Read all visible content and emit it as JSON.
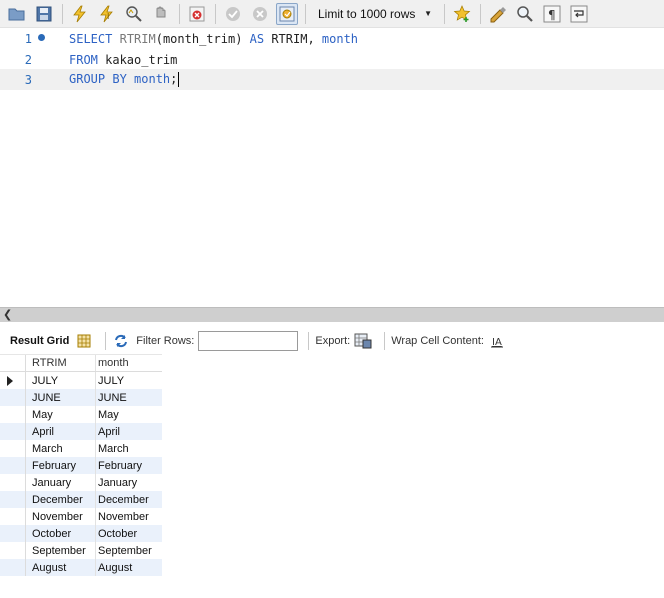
{
  "toolbar": {
    "limit_label": "Limit to 1000 rows",
    "icons": [
      "open-folder-icon",
      "save-icon",
      "execute-icon",
      "execute-current-icon",
      "explain-icon",
      "stop-icon",
      "toggle-error-icon",
      "commit-icon",
      "rollback-icon",
      "autocommit-icon",
      "add-snippet-icon",
      "beautify-icon",
      "find-icon",
      "invisible-chars-icon",
      "wrap-icon"
    ]
  },
  "editor": {
    "lines": [
      {
        "num": "1"
      },
      {
        "num": "2"
      },
      {
        "num": "3"
      }
    ],
    "l1": {
      "kw1": "SELECT",
      "fn": "RTRIM",
      "p1": "(month_trim) ",
      "kw2": "AS",
      "t2": " RTRIM, ",
      "kw3": "month"
    },
    "l2": {
      "kw1": "FROM",
      "t1": " kakao_trim"
    },
    "l3": {
      "kw1": "GROUP BY",
      "t1": " ",
      "kw2": "month",
      "t2": ";"
    }
  },
  "result_toolbar": {
    "result_grid": "Result Grid",
    "filter_rows": "Filter Rows:",
    "export": "Export:",
    "wrap": "Wrap Cell Content:"
  },
  "grid": {
    "columns": [
      "RTRIM",
      "month"
    ],
    "rows": [
      [
        "JULY",
        "JULY"
      ],
      [
        "JUNE",
        "JUNE"
      ],
      [
        "May",
        "May"
      ],
      [
        "April",
        "April"
      ],
      [
        "March",
        "March"
      ],
      [
        "February",
        "February"
      ],
      [
        "January",
        "January"
      ],
      [
        "December",
        "December"
      ],
      [
        "November",
        "November"
      ],
      [
        "October",
        "October"
      ],
      [
        "September",
        "September"
      ],
      [
        "August",
        "August"
      ]
    ]
  },
  "colors": {
    "keyword": "#2d62c4",
    "function": "#7a7a7a",
    "line_number": "#2a6ab8",
    "alt_row": "#eaf1fb"
  }
}
